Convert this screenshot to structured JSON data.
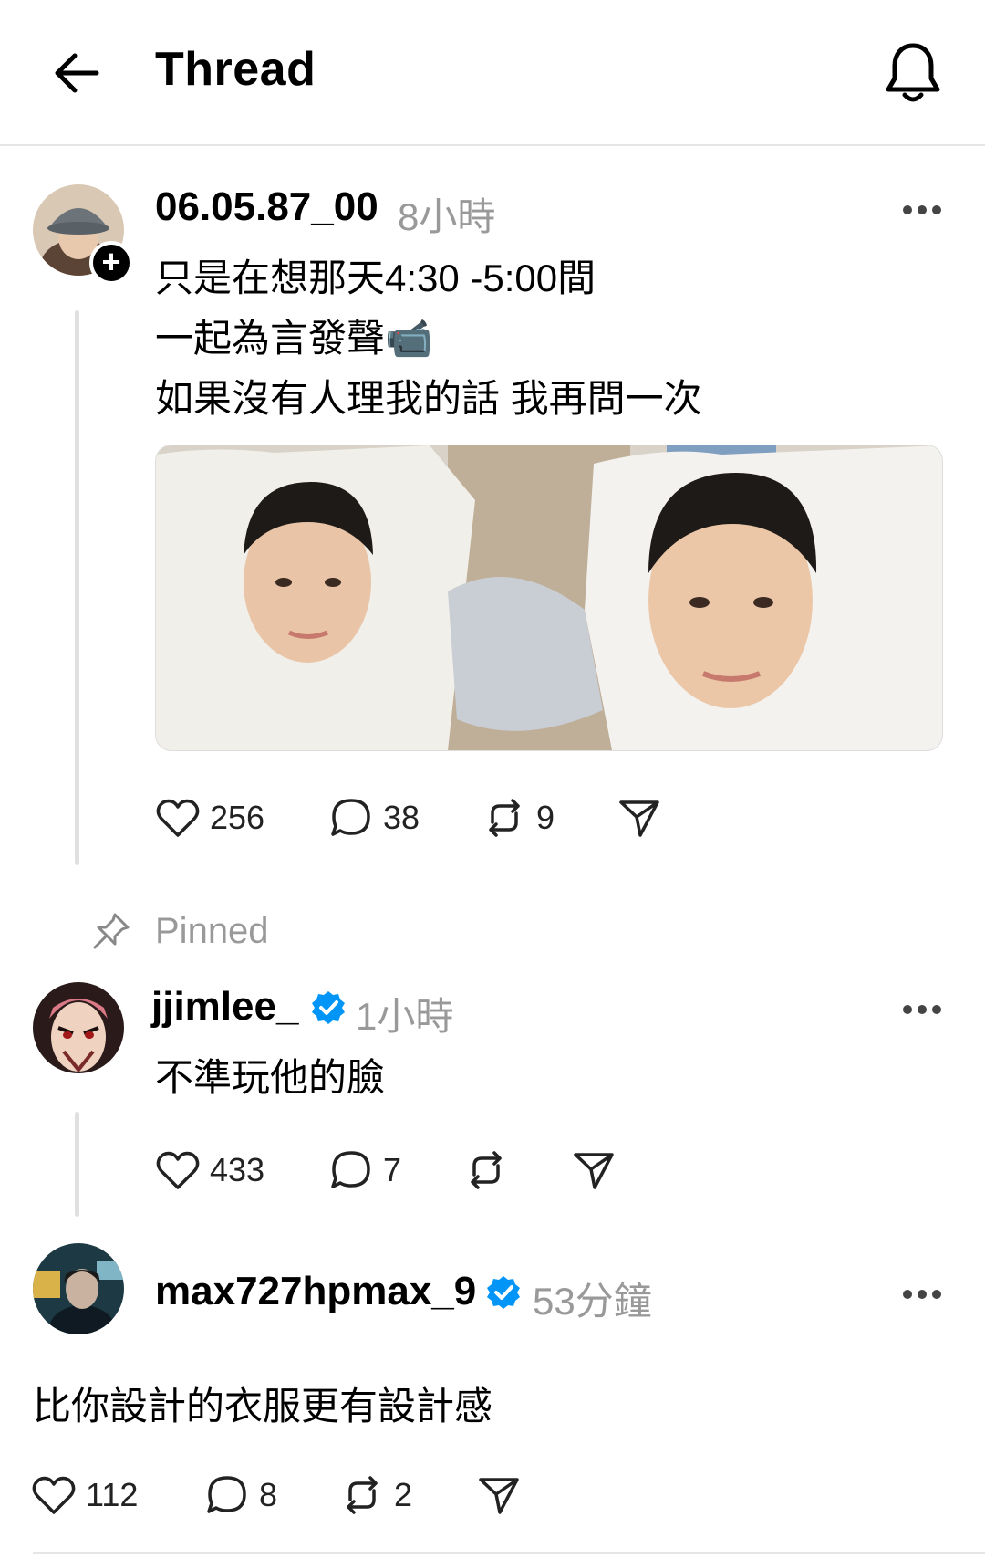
{
  "header": {
    "title": "Thread"
  },
  "post": {
    "username": "06.05.87_00",
    "time": "8小時",
    "lines": [
      "只是在想那天4:30 -5:00間",
      "一起為言發聲📹",
      "如果沒有人理我的話 我再問一次"
    ],
    "likes": "256",
    "comments": "38",
    "reposts": "9"
  },
  "pinned_label": "Pinned",
  "replies": [
    {
      "username": "jjimlee_",
      "time": "1小時",
      "text": "不準玩他的臉",
      "likes": "433",
      "comments": "7",
      "reposts": ""
    },
    {
      "username": "max727hpmax_9",
      "time": "53分鐘",
      "text": "比你設計的衣服更有設計感",
      "likes": "112",
      "comments": "8",
      "reposts": "2"
    }
  ],
  "colors": {
    "verified": "#0095f6",
    "muted": "#999999"
  }
}
